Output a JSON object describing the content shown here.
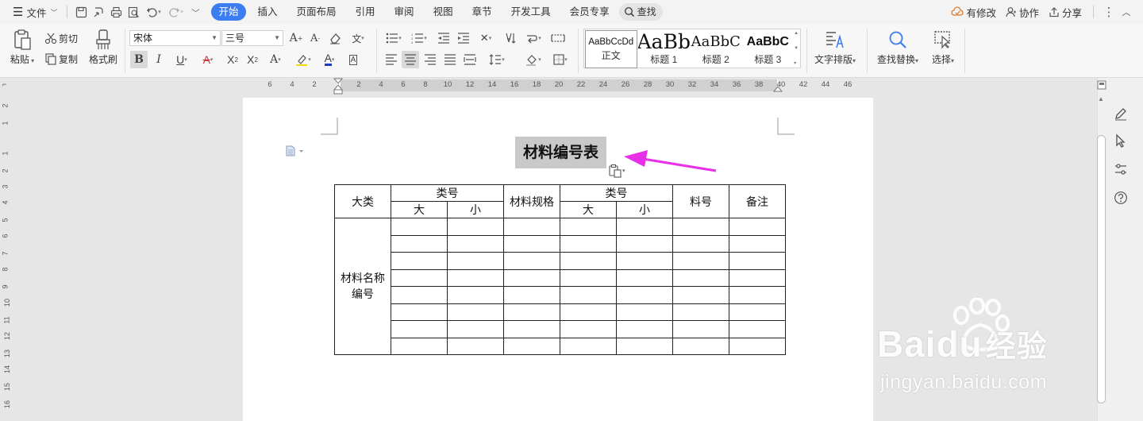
{
  "title_bar": {
    "menu_label": "文件",
    "tabs": [
      {
        "label": "开始",
        "active": true
      },
      {
        "label": "插入",
        "active": false
      },
      {
        "label": "页面布局",
        "active": false
      },
      {
        "label": "引用",
        "active": false
      },
      {
        "label": "审阅",
        "active": false
      },
      {
        "label": "视图",
        "active": false
      },
      {
        "label": "章节",
        "active": false
      },
      {
        "label": "开发工具",
        "active": false
      },
      {
        "label": "会员专享",
        "active": false
      }
    ],
    "search_label": "查找",
    "has_changes_label": "有修改",
    "collab_label": "协作",
    "share_label": "分享"
  },
  "ribbon": {
    "paste_label": "粘贴",
    "cut_label": "剪切",
    "copy_label": "复制",
    "format_painter_label": "格式刷",
    "font_name": "宋体",
    "font_size": "三号",
    "styles": [
      {
        "preview": "AaBbCcDd",
        "label": "正文"
      },
      {
        "preview": "AaBb",
        "label": "标题 1"
      },
      {
        "preview": "AaBbC",
        "label": "标题 2"
      },
      {
        "preview": "AaBbC",
        "label": "标题 3"
      }
    ],
    "text_layout_label": "文字排版",
    "find_replace_label": "查找替换",
    "select_label": "选择"
  },
  "ruler": {
    "h_ticks": [
      "6",
      "4",
      "2",
      "2",
      "4",
      "6",
      "8",
      "10",
      "12",
      "14",
      "16",
      "18",
      "20",
      "22",
      "24",
      "26",
      "28",
      "30",
      "32",
      "34",
      "36",
      "38",
      "40",
      "42",
      "44",
      "46"
    ],
    "v_ticks": [
      "2",
      "1",
      "1",
      "2",
      "3",
      "4",
      "5",
      "6",
      "7",
      "8",
      "9",
      "10",
      "11",
      "12",
      "13",
      "14",
      "15",
      "16"
    ]
  },
  "document": {
    "title": "材料编号表",
    "table": {
      "header_row1": {
        "c1": "大类",
        "c2": "类号",
        "c3": "材料规格",
        "c4": "类号",
        "c5": "料号",
        "c6": "备注"
      },
      "header_row2": {
        "a": "大",
        "b": "小",
        "c": "大",
        "d": "小"
      },
      "body_label_line1": "材料名称",
      "body_label_line2": "编号"
    }
  },
  "watermark": {
    "brand": "Baidu",
    "brand_cn": "经验",
    "url": "jingyan.baidu.com"
  },
  "colors": {
    "accent": "#3b7cf0",
    "arrow": "#e830e8",
    "selection": "#c9c9c9"
  }
}
